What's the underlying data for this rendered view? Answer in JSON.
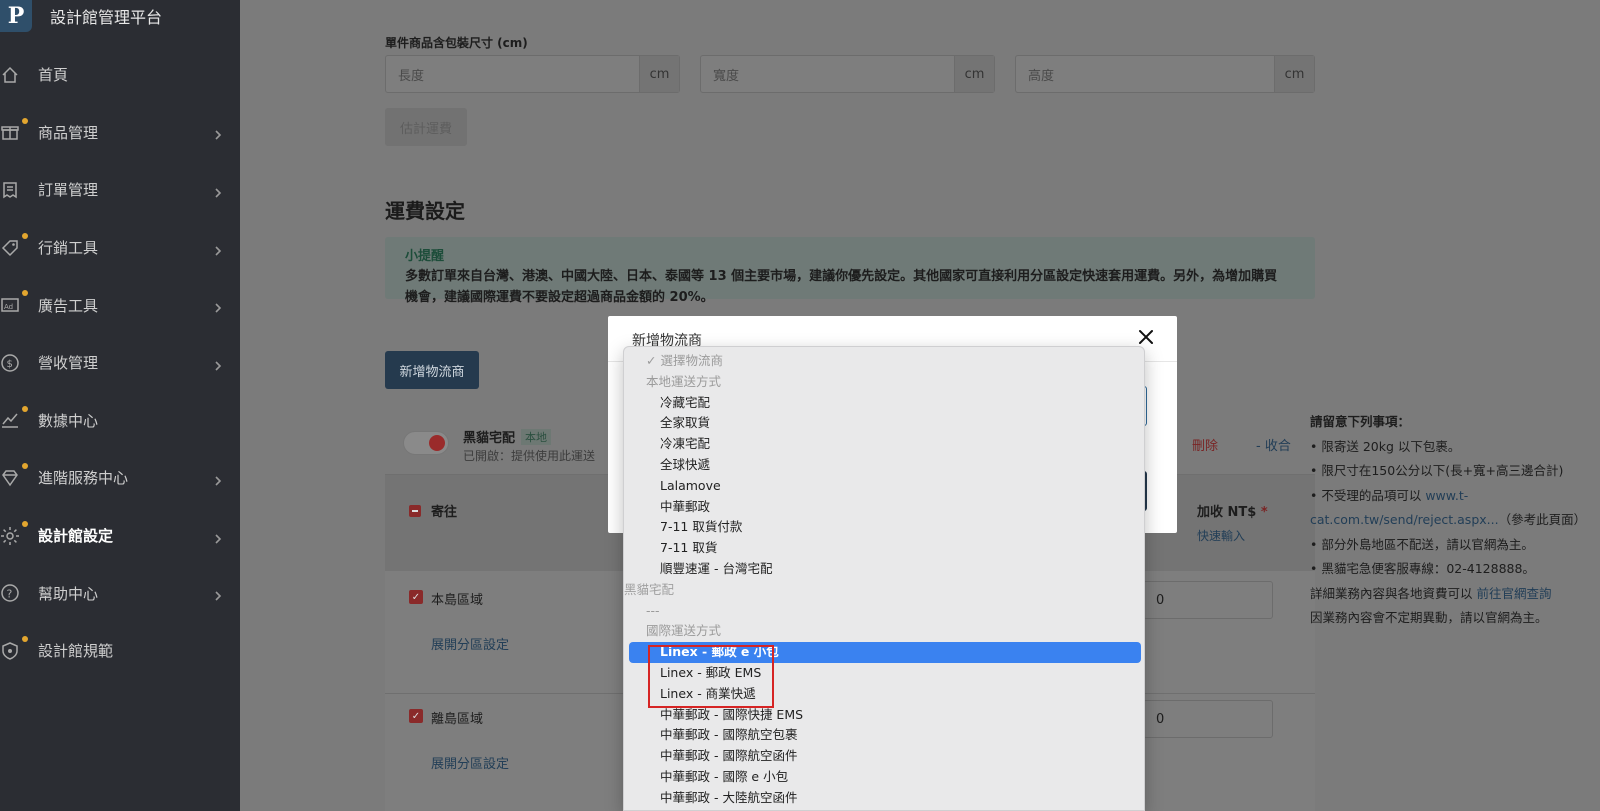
{
  "sidebar": {
    "brand_logo": "P",
    "brand_title": "設計館管理平台",
    "items": [
      {
        "label": "首頁",
        "icon": "home-icon",
        "dot": false,
        "chevron": false
      },
      {
        "label": "商品管理",
        "icon": "gift-icon",
        "dot": true,
        "chevron": true
      },
      {
        "label": "訂單管理",
        "icon": "receipt-icon",
        "dot": false,
        "chevron": true
      },
      {
        "label": "行銷工具",
        "icon": "tag-icon",
        "dot": true,
        "chevron": true
      },
      {
        "label": "廣告工具",
        "icon": "ad-icon",
        "dot": true,
        "chevron": true
      },
      {
        "label": "營收管理",
        "icon": "dollar-icon",
        "dot": false,
        "chevron": true
      },
      {
        "label": "數據中心",
        "icon": "chart-icon",
        "dot": true,
        "chevron": false
      },
      {
        "label": "進階服務中心",
        "icon": "diamond-icon",
        "dot": true,
        "chevron": true
      },
      {
        "label": "設計館設定",
        "icon": "gear-icon",
        "dot": true,
        "chevron": true,
        "active": true
      },
      {
        "label": "幫助中心",
        "icon": "help-icon",
        "dot": false,
        "chevron": true
      },
      {
        "label": "設計館規範",
        "icon": "shield-icon",
        "dot": true,
        "chevron": false
      }
    ]
  },
  "main": {
    "package_size_label": "單件商品含包裝尺寸 (cm)",
    "dims": [
      {
        "placeholder": "長度",
        "unit": "cm"
      },
      {
        "placeholder": "寬度",
        "unit": "cm"
      },
      {
        "placeholder": "高度",
        "unit": "cm"
      }
    ],
    "estimate_button": "估計運費",
    "section_title": "運費設定",
    "tip_title": "小提醒",
    "tip_line1": "多數訂單來自台灣、港澳、中國大陸、日本、泰國等 13 個主要市場，建議你優先設定。其他國家可直接利用分區設定快速套用運費。另外，為增加購買",
    "tip_line2": "機會，建議國際運費不要設定超過商品金額的 20%。",
    "add_carrier_button": "新增物流商",
    "carrier": {
      "name": "黑貓宅配",
      "badge": "本地",
      "status": "已開啟：提供使用此運送",
      "delete": "刪除",
      "collapse": "- 收合",
      "th_send": "寄往",
      "th_cod": "加收 NT$",
      "th_required": "*",
      "th_quick": "快速輸入",
      "rows": [
        {
          "label": "本島區域",
          "link": "展開分區設定",
          "value": "0"
        },
        {
          "label": "離島區域",
          "link": "展開分區設定",
          "value": "0"
        }
      ]
    },
    "notes": {
      "title": "請留意下列事項：",
      "line1": "• 限寄送 20kg 以下包裹。",
      "line2": "• 限尺寸在150公分以下(長+寬+高三邊合計)",
      "line3_prefix": "• 不受理的品項可以 ",
      "line3_link_a": "www.t-",
      "line3_link_b": "cat.com.tw/send/reject.aspx...",
      "line3_suffix": "（參考此頁面）",
      "line4": "• 部分外島地區不配送，請以官網為主。",
      "line5": "• 黑貓宅急便客服專線：02-4128888。",
      "line6_prefix": "詳細業務內容與各地資費可以 ",
      "line6_link": "前往官網查詢",
      "line7": "因業務內容會不定期異動，請以官網為主。"
    }
  },
  "modal": {
    "title": "新增物流商"
  },
  "dropdown": {
    "options": [
      {
        "label": "✓ 選擇物流商",
        "kind": "checked"
      },
      {
        "label": "本地運送方式",
        "kind": "group"
      },
      {
        "label": "冷藏宅配",
        "kind": "item"
      },
      {
        "label": "全家取貨",
        "kind": "item"
      },
      {
        "label": "冷凍宅配",
        "kind": "item"
      },
      {
        "label": "全球快遞",
        "kind": "item"
      },
      {
        "label": "Lalamove",
        "kind": "item"
      },
      {
        "label": "中華郵政",
        "kind": "item"
      },
      {
        "label": "7-11 取貨付款",
        "kind": "item"
      },
      {
        "label": "7-11 取貨",
        "kind": "item"
      },
      {
        "label": "順豐速運 - 台灣宅配",
        "kind": "item"
      },
      {
        "label": "黑貓宅配",
        "kind": "disabled"
      },
      {
        "label": "---",
        "kind": "group"
      },
      {
        "label": "國際運送方式",
        "kind": "group"
      },
      {
        "label": "Linex - 郵政 e 小包",
        "kind": "selected"
      },
      {
        "label": "Linex - 郵政 EMS",
        "kind": "item"
      },
      {
        "label": "Linex - 商業快遞",
        "kind": "item"
      },
      {
        "label": "中華郵政 - 國際快捷 EMS",
        "kind": "item"
      },
      {
        "label": "中華郵政 - 國際航空包裹",
        "kind": "item"
      },
      {
        "label": "中華郵政 - 國際航空函件",
        "kind": "item"
      },
      {
        "label": "中華郵政 - 國際 e 小包",
        "kind": "item"
      },
      {
        "label": "中華郵政 - 大陸航空函件",
        "kind": "item"
      }
    ]
  },
  "colors": {
    "sidebar_bg": "#2b2d33",
    "selected_option": "#3a82f0",
    "highlight_border": "#d62424",
    "dot": "#e3a62f"
  }
}
